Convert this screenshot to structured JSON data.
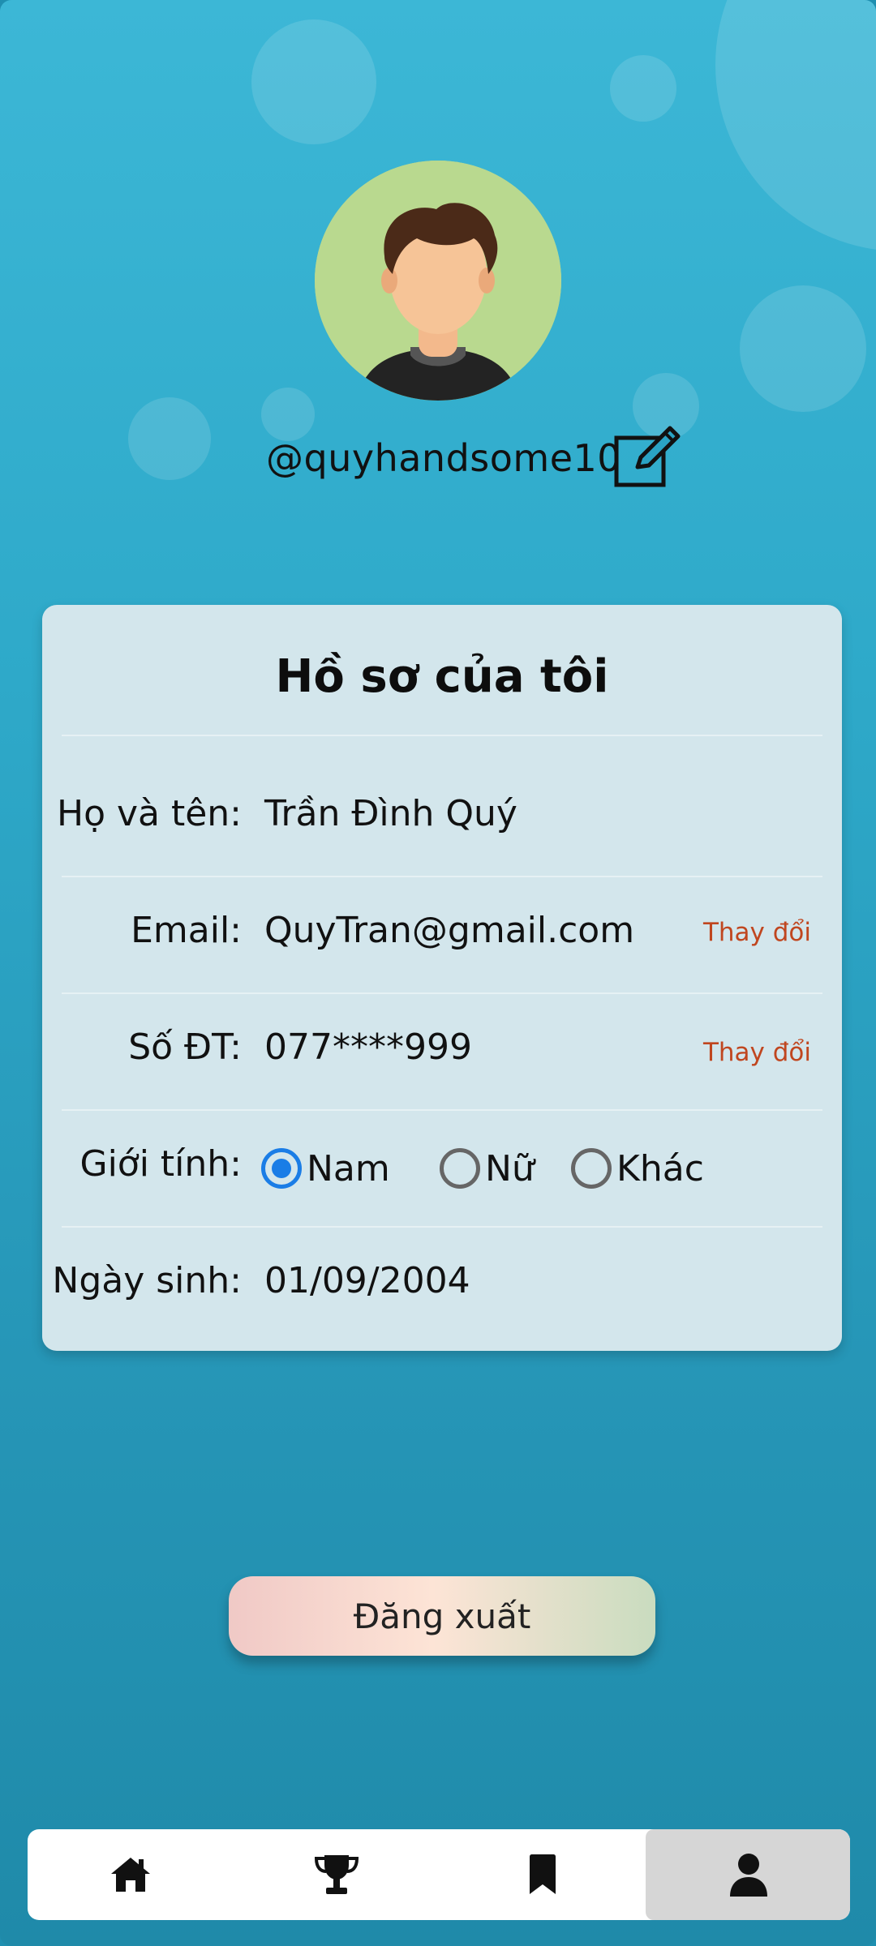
{
  "profile": {
    "username": "@quyhandsome10",
    "avatar_icon": "avatar-boy-icon",
    "edit_icon": "edit-pencil-icon"
  },
  "card": {
    "title": "Hồ sơ của tôi",
    "rows": [
      {
        "label": "Họ và tên:",
        "value": "Trần Đình Quý"
      },
      {
        "label": "Email:",
        "value": "QuyTran@gmail.com",
        "action": "Thay đổi"
      },
      {
        "label": "Số ĐT:",
        "value": "077****999",
        "action": "Thay đổi"
      },
      {
        "label": "Giới tính:"
      },
      {
        "label": "Ngày sinh:",
        "value": "01/09/2004"
      }
    ],
    "gender_options": [
      {
        "label": "Nam",
        "checked": true
      },
      {
        "label": "Nữ",
        "checked": false
      },
      {
        "label": "Khác",
        "checked": false
      }
    ]
  },
  "logout_label": "Đăng xuất",
  "nav": [
    {
      "icon": "home-icon",
      "active": false
    },
    {
      "icon": "trophy-icon",
      "active": false
    },
    {
      "icon": "bookmark-icon",
      "active": false
    },
    {
      "icon": "user-icon",
      "active": true
    }
  ],
  "colors": {
    "background_top": "#3cb7d6",
    "background_bottom": "#1f8aa9",
    "card": "#d3e6ec",
    "action_text": "#c0461f",
    "radio_selected": "#1a7de6"
  }
}
